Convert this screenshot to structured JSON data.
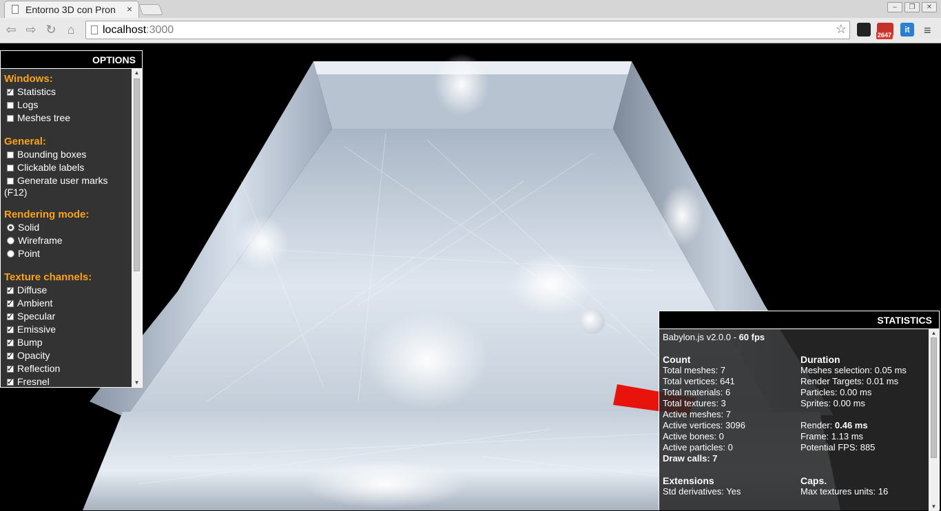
{
  "browser": {
    "tab_title": "Entorno 3D con Pron",
    "tab_close": "×",
    "url_host": "localhost",
    "url_port": ":3000",
    "mail_badge": "2647",
    "it_label": "it"
  },
  "options": {
    "header": "OPTIONS",
    "sections": {
      "windows": {
        "title": "Windows:",
        "items": [
          {
            "label": "Statistics",
            "checked": true
          },
          {
            "label": "Logs",
            "checked": false
          },
          {
            "label": "Meshes tree",
            "checked": false
          }
        ]
      },
      "general": {
        "title": "General:",
        "items": [
          {
            "label": "Bounding boxes",
            "checked": false
          },
          {
            "label": "Clickable labels",
            "checked": false
          },
          {
            "label": "Generate user marks",
            "checked": false
          }
        ],
        "wrap_text": "(F12)"
      },
      "rendering": {
        "title": "Rendering mode:",
        "items": [
          {
            "label": "Solid",
            "checked": true
          },
          {
            "label": "Wireframe",
            "checked": false
          },
          {
            "label": "Point",
            "checked": false
          }
        ]
      },
      "texture": {
        "title": "Texture channels:",
        "items": [
          {
            "label": "Diffuse",
            "checked": true
          },
          {
            "label": "Ambient",
            "checked": true
          },
          {
            "label": "Specular",
            "checked": true
          },
          {
            "label": "Emissive",
            "checked": true
          },
          {
            "label": "Bump",
            "checked": true
          },
          {
            "label": "Opacity",
            "checked": true
          },
          {
            "label": "Reflection",
            "checked": true
          },
          {
            "label": "Fresnel",
            "checked": true
          }
        ]
      }
    }
  },
  "stats": {
    "header": "STATISTICS",
    "version": "Babylon.js v2.0.0 - ",
    "fps": "60 fps",
    "count": {
      "title": "Count",
      "total_meshes": "Total meshes: 7",
      "total_vertices": "Total vertices: 641",
      "total_materials": "Total materials: 6",
      "total_textures": "Total textures: 3",
      "active_meshes": "Active meshes: 7",
      "active_vertices": "Active vertices: 3096",
      "active_bones": "Active bones: 0",
      "active_particles": "Active particles: 0",
      "draw_calls": "Draw calls: 7"
    },
    "duration": {
      "title": "Duration",
      "meshes_selection": "Meshes selection: 0.05 ms",
      "render_targets": "Render Targets: 0.01 ms",
      "particles": "Particles: 0.00 ms",
      "sprites": "Sprites: 0.00 ms",
      "render_label": "Render: ",
      "render_value": "0.46 ms",
      "frame": "Frame: 1.13 ms",
      "potential_fps": "Potential FPS: 885"
    },
    "extensions": {
      "title": "Extensions",
      "std_derivatives": "Std derivatives: Yes"
    },
    "caps": {
      "title": "Caps.",
      "max_textures_units": "Max textures units: 16"
    }
  },
  "colors": {
    "section_title": "#f9a31c",
    "panel_bg": "#333333",
    "cylinder": "#e8140c"
  }
}
